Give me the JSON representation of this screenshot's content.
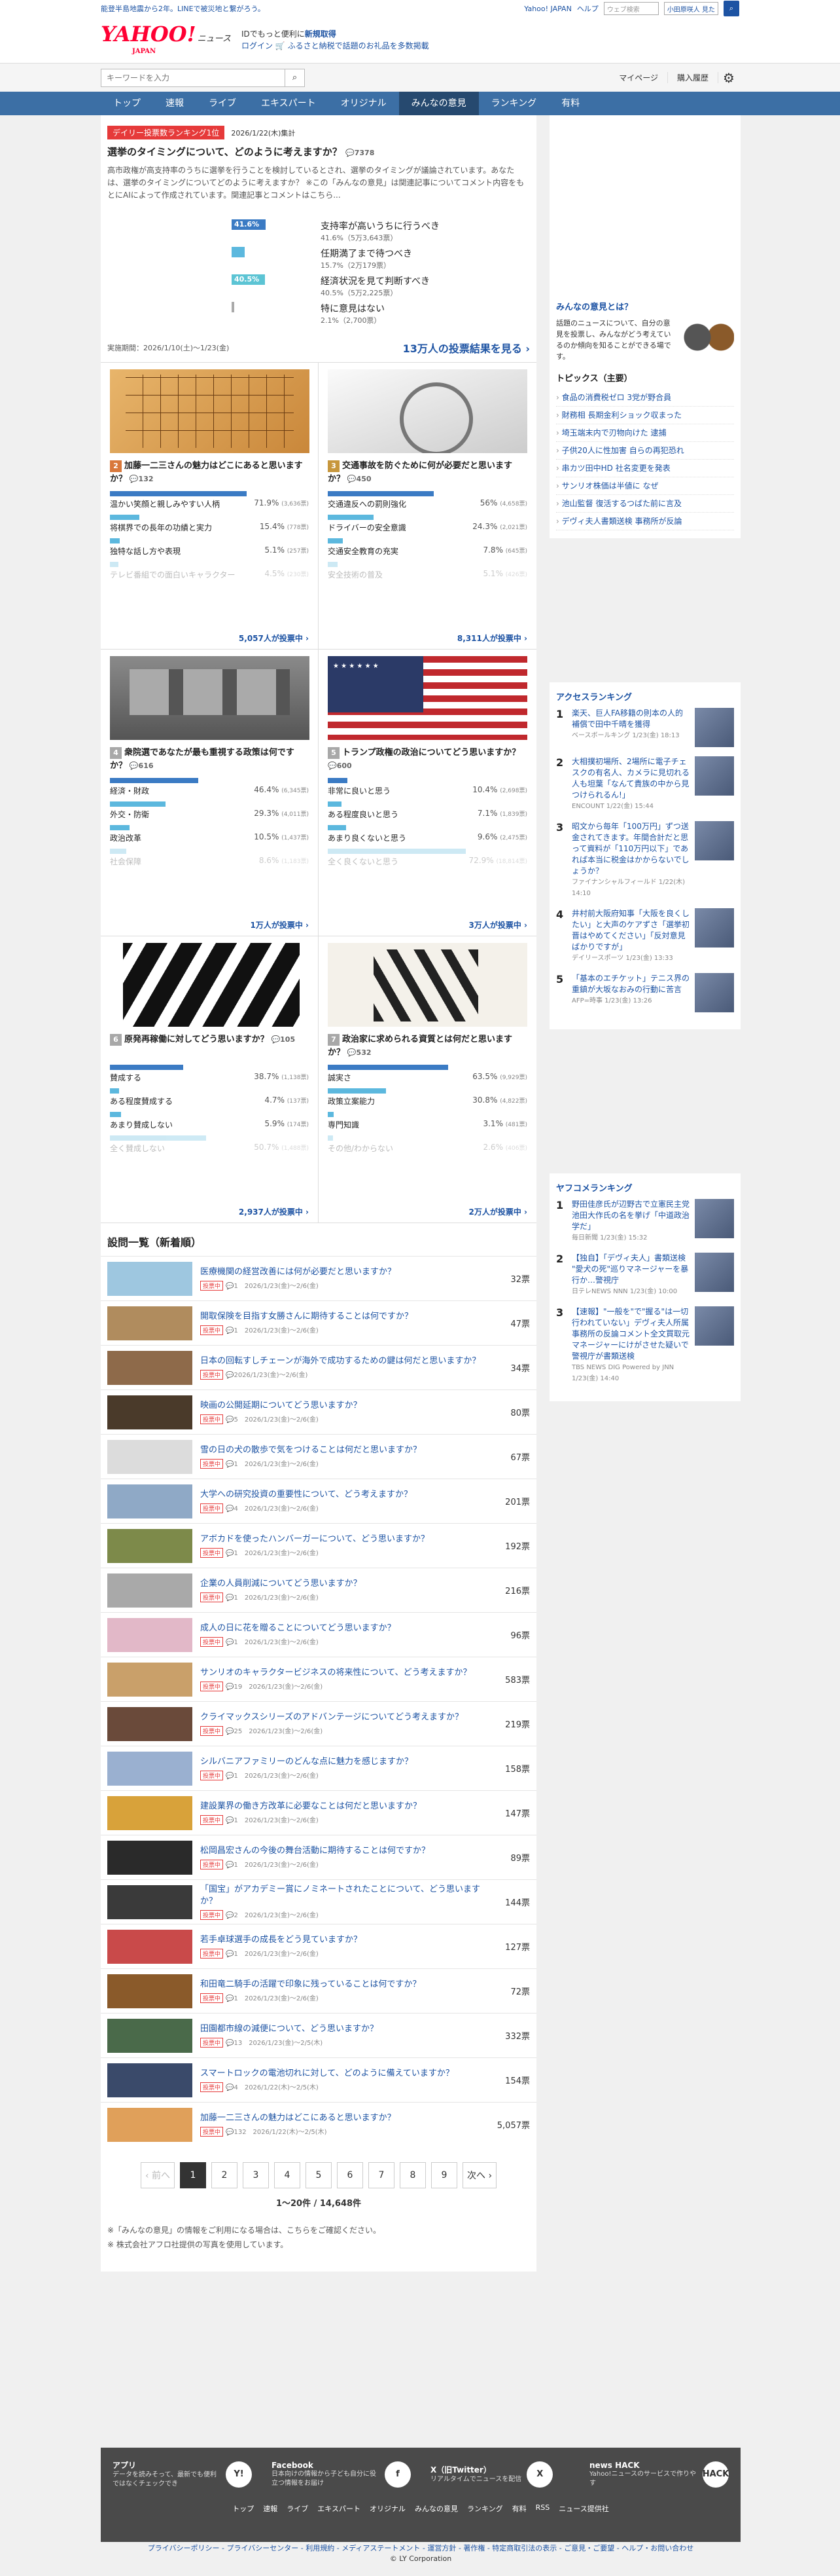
{
  "topbar": {
    "notice": "能登半島地震から2年。LINEで被災地と繋がろう。",
    "links": [
      "Yahoo! JAPAN",
      "ヘルプ"
    ],
    "search_placeholder": "ウェブ検索",
    "select_label": "小田原咲人 見た",
    "search_icon": "search-icon"
  },
  "header": {
    "logo": "YAHOO!",
    "logo_sub": "JAPAN",
    "service": "ニュース",
    "promo1": "IDでもっと便利に",
    "promo1_link": "新規取得",
    "login": "ログイン",
    "promo2": "ふるさと納税で話題のお礼品を多数掲載"
  },
  "subbar": {
    "search_placeholder": "キーワードを入力",
    "links": [
      "マイページ",
      "購入履歴"
    ]
  },
  "nav": [
    "トップ",
    "速報",
    "ライブ",
    "エキスパート",
    "オリジナル",
    "みんなの意見",
    "ランキング",
    "有料"
  ],
  "featured": {
    "badge": "デイリー投票数ランキング1位",
    "date": "2026/1/22(木)集計",
    "title": "選挙のタイミングについて、どのように考えますか？",
    "comments": "7378",
    "desc": "高市政権が高支持率のうちに選挙を行うことを検討しているとされ、選挙のタイミングが議論されています。あなたは、選挙のタイミングについてどのように考えますか？ ※この「みんなの意見」は関連記事についてコメント内容をもとにAIによって作成されています。関連記事とコメントはこちら...",
    "options": [
      {
        "label": "支持率が高いうちに行うべき",
        "pct": 41.6,
        "pct_text": "41.6%",
        "detail": "41.6%（5万3,643票）"
      },
      {
        "label": "任期満了まで待つべき",
        "pct": 15.7,
        "pct_text": "",
        "detail": "15.7%（2万179票）"
      },
      {
        "label": "経済状況を見て判断すべき",
        "pct": 40.5,
        "pct_text": "40.5%",
        "detail": "40.5%（5万2,225票）"
      },
      {
        "label": "特に意見はない",
        "pct": 2.1,
        "pct_text": "",
        "detail": "2.1%（2,700票）"
      }
    ],
    "period": "実施期間：2026/1/10(土)〜1/23(金)",
    "total": "13万人の投票結果を見る ›"
  },
  "cards": [
    {
      "rank": "2",
      "title": "加藤一二三さんの魅力はどこにあると思いますか？",
      "comments": "132",
      "img": "shogi",
      "options": [
        {
          "label": "温かい笑顔と親しみやすい人柄",
          "pct": 71.9,
          "val": "71.9%",
          "votes": "(3,636票)"
        },
        {
          "label": "将棋界での長年の功績と実力",
          "pct": 15.4,
          "val": "15.4%",
          "votes": "(778票)"
        },
        {
          "label": "独特な話し方や表現",
          "pct": 5.1,
          "val": "5.1%",
          "votes": "(257票)"
        },
        {
          "label": "テレビ番組での面白いキャラクター",
          "pct": 4.5,
          "val": "4.5%",
          "votes": "(230票)"
        }
      ],
      "total": "5,057人が投票中 ›"
    },
    {
      "rank": "3",
      "title": "交通事故を防ぐために何が必要だと思いますか？",
      "comments": "450",
      "img": "car",
      "options": [
        {
          "label": "交通違反への罰則強化",
          "pct": 56,
          "val": "56%",
          "votes": "(4,658票)"
        },
        {
          "label": "ドライバーの安全意識",
          "pct": 24.3,
          "val": "24.3%",
          "votes": "(2,021票)"
        },
        {
          "label": "交通安全教育の充実",
          "pct": 7.8,
          "val": "7.8%",
          "votes": "(645票)"
        },
        {
          "label": "安全技術の普及",
          "pct": 5.1,
          "val": "5.1%",
          "votes": "(426票)"
        }
      ],
      "total": "8,311人が投票中 ›"
    },
    {
      "rank": "4",
      "title": "衆院選であなたが最も重視する政策は何ですか？",
      "comments": "616",
      "img": "stone",
      "options": [
        {
          "label": "経済・財政",
          "pct": 46.4,
          "val": "46.4%",
          "votes": "(6,345票)"
        },
        {
          "label": "外交・防衛",
          "pct": 29.3,
          "val": "29.3%",
          "votes": "(4,011票)"
        },
        {
          "label": "政治改革",
          "pct": 10.5,
          "val": "10.5%",
          "votes": "(1,437票)"
        },
        {
          "label": "社会保障",
          "pct": 8.6,
          "val": "8.6%",
          "votes": "(1,183票)"
        }
      ],
      "total": "1万人が投票中 ›"
    },
    {
      "rank": "5",
      "title": "トランプ政権の政治についてどう思いますか？",
      "comments": "600",
      "img": "flag",
      "options": [
        {
          "label": "非常に良いと思う",
          "pct": 10.4,
          "val": "10.4%",
          "votes": "(2,698票)"
        },
        {
          "label": "ある程度良いと思う",
          "pct": 7.1,
          "val": "7.1%",
          "votes": "(1,839票)"
        },
        {
          "label": "あまり良くないと思う",
          "pct": 9.6,
          "val": "9.6%",
          "votes": "(2,475票)"
        },
        {
          "label": "全く良くないと思う",
          "pct": 72.9,
          "val": "72.9%",
          "votes": "(18,814票)"
        }
      ],
      "total": "3万人が投票中 ›"
    },
    {
      "rank": "6",
      "title": "原発再稼働に対してどう思いますか？",
      "comments": "105",
      "img": "kanji",
      "options": [
        {
          "label": "賛成する",
          "pct": 38.7,
          "val": "38.7%",
          "votes": "(1,138票)"
        },
        {
          "label": "ある程度賛成する",
          "pct": 4.7,
          "val": "4.7%",
          "votes": "(137票)"
        },
        {
          "label": "あまり賛成しない",
          "pct": 5.9,
          "val": "5.9%",
          "votes": "(174票)"
        },
        {
          "label": "全く賛成しない",
          "pct": 50.7,
          "val": "50.7%",
          "votes": "(1,488票)"
        }
      ],
      "total": "2,937人が投票中 ›"
    },
    {
      "rank": "7",
      "title": "政治家に求められる資質とは何だと思いますか？",
      "comments": "532",
      "img": "paper",
      "options": [
        {
          "label": "誠実さ",
          "pct": 63.5,
          "val": "63.5%",
          "votes": "(9,929票)"
        },
        {
          "label": "政策立案能力",
          "pct": 30.8,
          "val": "30.8%",
          "votes": "(4,822票)"
        },
        {
          "label": "専門知識",
          "pct": 3.1,
          "val": "3.1%",
          "votes": "(481票)"
        },
        {
          "label": "その他/わからない",
          "pct": 2.6,
          "val": "2.6%",
          "votes": "(406票)"
        }
      ],
      "total": "2万人が投票中 ›"
    }
  ],
  "list": {
    "heading": "設問一覧（新着順）",
    "status": "投票中",
    "items": [
      {
        "title": "医療機関の経営改善には何が必要だと思いますか？",
        "meta": "1　2026/1/23(金)〜2/6(金)",
        "votes": "32票",
        "c": "#9ec7e0"
      },
      {
        "title": "開取保険を目指す女勝さんに期待することは何ですか？",
        "meta": "1　2026/1/23(金)〜2/6(金)",
        "votes": "47票",
        "c": "#b08c5e"
      },
      {
        "title": "日本の回転すしチェーンが海外で成功するための鍵は何だと思いますか？",
        "meta": "2026/1/23(金)〜2/6(金)",
        "votes": "34票",
        "c": "#8e6a4a"
      },
      {
        "title": "映画の公開延期についてどう思いますか？",
        "meta": "5　2026/1/23(金)〜2/6(金)",
        "votes": "80票",
        "c": "#4a3a2a"
      },
      {
        "title": "雪の日の犬の散歩で気をつけることは何だと思いますか？",
        "meta": "1　2026/1/23(金)〜2/6(金)",
        "votes": "67票",
        "c": "#dcdcdc"
      },
      {
        "title": "大学への研究投資の重要性について、どう考えますか？",
        "meta": "4　2026/1/23(金)〜2/6(金)",
        "votes": "201票",
        "c": "#8fa9c6"
      },
      {
        "title": "アボカドを使ったハンバーガーについて、どう思いますか？",
        "meta": "1　2026/1/23(金)〜2/6(金)",
        "votes": "192票",
        "c": "#7d8a4a"
      },
      {
        "title": "企業の人員削減についてどう思いますか？",
        "meta": "1　2026/1/23(金)〜2/6(金)",
        "votes": "216票",
        "c": "#a9a9a9"
      },
      {
        "title": "成人の日に花を贈ることについてどう思いますか？",
        "meta": "1　2026/1/23(金)〜2/6(金)",
        "votes": "96票",
        "c": "#e2b8c8"
      },
      {
        "title": "サンリオのキャラクタービジネスの将来性について、どう考えますか？",
        "meta": "19　2026/1/23(金)〜2/6(金)",
        "votes": "583票",
        "c": "#c9a06a"
      },
      {
        "title": "クライマックスシリーズのアドバンテージについてどう考えますか？",
        "meta": "25　2026/1/23(金)〜2/6(金)",
        "votes": "219票",
        "c": "#6a4a3a"
      },
      {
        "title": "シルバニアファミリーのどんな点に魅力を感じますか？",
        "meta": "1　2026/1/23(金)〜2/6(金)",
        "votes": "158票",
        "c": "#9ab0d0"
      },
      {
        "title": "建設業界の働き方改革に必要なことは何だと思いますか？",
        "meta": "1　2026/1/23(金)〜2/6(金)",
        "votes": "147票",
        "c": "#d8a23a"
      },
      {
        "title": "松岡昌宏さんの今後の舞台活動に期待することは何ですか？",
        "meta": "1　2026/1/23(金)〜2/6(金)",
        "votes": "89票",
        "c": "#2a2a2a"
      },
      {
        "title": "「国宝」がアカデミー賞にノミネートされたことについて、どう思いますか？",
        "meta": "2　2026/1/23(金)〜2/6(金)",
        "votes": "144票",
        "c": "#3a3a3a"
      },
      {
        "title": "若手卓球選手の成長をどう見ていますか？",
        "meta": "1　2026/1/23(金)〜2/6(金)",
        "votes": "127票",
        "c": "#c94a4a"
      },
      {
        "title": "和田竜二騎手の活躍で印象に残っていることは何ですか？",
        "meta": "1　2026/1/23(金)〜2/6(金)",
        "votes": "72票",
        "c": "#8a5a2a"
      },
      {
        "title": "田園都市線の減便について、どう思いますか？",
        "meta": "13　2026/1/23(金)〜2/5(木)",
        "votes": "332票",
        "c": "#4a6a4a"
      },
      {
        "title": "スマートロックの電池切れに対して、どのように備えていますか？",
        "meta": "4　2026/1/22(木)〜2/5(木)",
        "votes": "154票",
        "c": "#3a4a6a"
      },
      {
        "title": "加藤一二三さんの魅力はどこにあると思いますか？",
        "meta": "132　2026/1/22(木)〜2/5(木)",
        "votes": "5,057票",
        "c": "#e0a05a"
      }
    ]
  },
  "pager": {
    "prev": "‹ 前へ",
    "pages": [
      "1",
      "2",
      "3",
      "4",
      "5",
      "6",
      "7",
      "8",
      "9"
    ],
    "next": "次へ ›",
    "count": "1〜20件 / 14,648件"
  },
  "notes": [
    "※「みんなの意見」の情報をご利用になる場合は、こちらをご確認ください。",
    "※ 株式会社アフロ社提供の写真を使用しています。"
  ],
  "side": {
    "about_title": "みんなの意見とは？",
    "about_text": "話題のニュースについて、自分の意見を投票し、みんながどう考えているのか傾向を知ることができる場です。",
    "topics_title": "トピックス（主要）",
    "topics": [
      "食品の消費税ゼロ 3党が野合員",
      "財務相 長期金利ショック収まった",
      "埼玉端末内で刃物向けた 逮捕",
      "子供20人に性加害 自らの再犯恐れ",
      "串カツ田中HD 社名変更を発表",
      "サンリオ株価は半値に なぜ",
      "池山監督 復活するつばた前に言及",
      "デヴィ夫人書類送検 事務所が反論"
    ],
    "access_title": "アクセスランキング",
    "access": [
      {
        "n": "1",
        "t": "楽天、巨人FA移籍の則本の人的補償で田中千晴を獲得",
        "s": "ベースボールキング 1/23(金) 18:13"
      },
      {
        "n": "2",
        "t": "大相撲初場所、2場所に電子チェスクの有名人、カメラに見切れる人も坦葉「なんて貴族の中から見つけられるん!」",
        "s": "ENCOUNT 1/22(金) 15:44"
      },
      {
        "n": "3",
        "t": "昭文から毎年「100万円」ずつ送金されてきます。年間合計だと思って資料が「110万円以下」であれば本当に税金はかからないでしょうか？",
        "s": "ファイナンシャルフィールド 1/22(木) 14:10"
      },
      {
        "n": "4",
        "t": "井村前大阪府知事「大阪を良くしたい」と大声のケアずさ「選挙初晋はやめてください」「反対意見ばかりですが」",
        "s": "デイリースポーツ 1/23(金) 13:33"
      },
      {
        "n": "5",
        "t": "「基本のエチケット」テニス界の重鎮が大坂なおみの行動に苦言",
        "s": "AFP=時事 1/23(金) 13:26"
      }
    ],
    "yahoo_title": "ヤフコメランキング",
    "yahoo": [
      {
        "n": "1",
        "t": "野田佳彦氏が辺野古で立憲民主党 池田大作氏の名を挙げ「中道政治学だ」",
        "s": "毎日新聞 1/23(金) 15:32"
      },
      {
        "n": "2",
        "t": "【独自】「デヴィ夫人」書類送検 \"愛犬の死\"巡りマネージャーを暴行か…警視庁",
        "s": "日テレNEWS NNN 1/23(金) 10:00"
      },
      {
        "n": "3",
        "t": "【速報】\"一般を\"で\"握る\"は一切行われていない」デヴィ夫人所属事務所の反論コメント全文買取元マネージャーにけがさせた疑いで警視庁が書類送検",
        "s": "TBS NEWS DIG Powered by JNN 1/23(金) 14:40"
      }
    ]
  },
  "footer": {
    "apps": [
      {
        "t": "アプリ",
        "d": "データを読みそって、最新でも便利ではなくチェックでき",
        "i": "Y!"
      },
      {
        "t": "Facebook",
        "d": "日本向けの情報から子ども自分に役立つ情報をお届け",
        "i": "f"
      },
      {
        "t": "X（旧Twitter）",
        "d": "リアルタイムでニュースを配信",
        "i": "X"
      },
      {
        "t": "news HACK",
        "d": "Yahoo!ニュースのサービスで作りやす",
        "i": "HACK"
      }
    ],
    "links": [
      "トップ",
      "速報",
      "ライブ",
      "エキスパート",
      "オリジナル",
      "みんなの意見",
      "ランキング",
      "有料",
      "RSS",
      "ニュース提供社"
    ],
    "legal": "プライバシーポリシー - プライバシーセンター - 利用規約 - メディアステートメント - 運営方針 - 著作権 - 特定商取引法の表示 - ご意見・ご要望 - ヘルプ・お問い合わせ",
    "copyright": "© LY Corporation"
  }
}
